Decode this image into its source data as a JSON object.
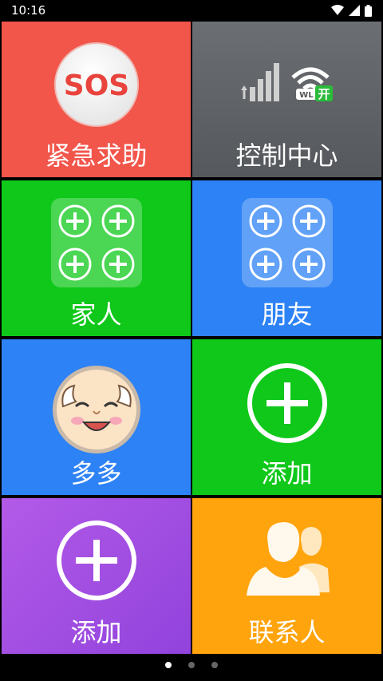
{
  "status_bar": {
    "time": "10:16"
  },
  "tiles": {
    "sos": {
      "icon_text": "SOS",
      "label": "紧急求助",
      "color": "#f2554a"
    },
    "control": {
      "label": "控制中心",
      "color": "#5f6368",
      "wifi_badge": "WL",
      "on_badge": "开"
    },
    "family": {
      "label": "家人",
      "color": "#0fc81a"
    },
    "friends": {
      "label": "朋友",
      "color": "#2d82f5"
    },
    "duoduo": {
      "label": "多多",
      "color": "#2d82f5"
    },
    "add1": {
      "label": "添加",
      "color": "#0fc81a"
    },
    "add2": {
      "label": "添加",
      "color": "#a04de6"
    },
    "contacts": {
      "label": "联系人",
      "color": "#ffa40d"
    }
  },
  "pager": {
    "pages": 3,
    "active": 0
  }
}
